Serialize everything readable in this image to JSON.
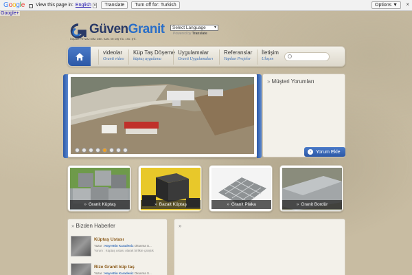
{
  "translate_bar": {
    "logo": "Google",
    "prompt": "View this page in:",
    "language": "English",
    "caret": "▾",
    "translate_button": "Translate",
    "turn_off_button": "Turn off for: Turkish",
    "options_button": "Options ▼",
    "close": "×"
  },
  "google_plus": "Google+",
  "logo": {
    "name_part1": "Güven",
    "name_part2": "Granit",
    "tagline": "İNŞAAT PEYZAJ MİM. DEK. SAN. VE DIŞ TİC. LTD. ŞTİ."
  },
  "language_select": {
    "value": "Select Language",
    "powered_prefix": "Powered by",
    "powered_brand": "Translate"
  },
  "nav": {
    "items": [
      {
        "title": "videolar",
        "sub": "Granit video"
      },
      {
        "title": "Küp Taş Döşeme",
        "sub": "küptaş uygulama"
      },
      {
        "title": "Uygulamalar",
        "sub": "Granit Uygulamaları"
      },
      {
        "title": "Referanslar",
        "sub": "Yapılan Projeler"
      },
      {
        "title": "İletişim",
        "sub": "Ulaşım"
      }
    ]
  },
  "testimonials": {
    "title": "Müşteri Yorumları",
    "button": "Yorum Ekle"
  },
  "slider": {
    "dot_count": 8,
    "active_dot": 4
  },
  "products": [
    {
      "label": "Granit Küptaş"
    },
    {
      "label": "Bazalt Küptaş"
    },
    {
      "label": "Granit Plaka"
    },
    {
      "label": "Granit Bordür"
    }
  ],
  "news": {
    "title": "Bizden Haberler",
    "items": [
      {
        "headline": "Küptaş Ustası",
        "author_prefix": "Yazar :",
        "author": "Hayrettin Karadeniz",
        "reads": "Okunma S...",
        "excerpt": "Yorum : Küptaş ustası olarak birlikte çalıştık"
      },
      {
        "headline": "Rize Granit küp taş",
        "author_prefix": "Yazar :",
        "author": "Hayrettin Karadeniz",
        "reads": "Okunma S...",
        "excerpt": ""
      }
    ]
  },
  "colors": {
    "brand_blue": "#2c58a6",
    "accent_orange": "#f0a020"
  }
}
